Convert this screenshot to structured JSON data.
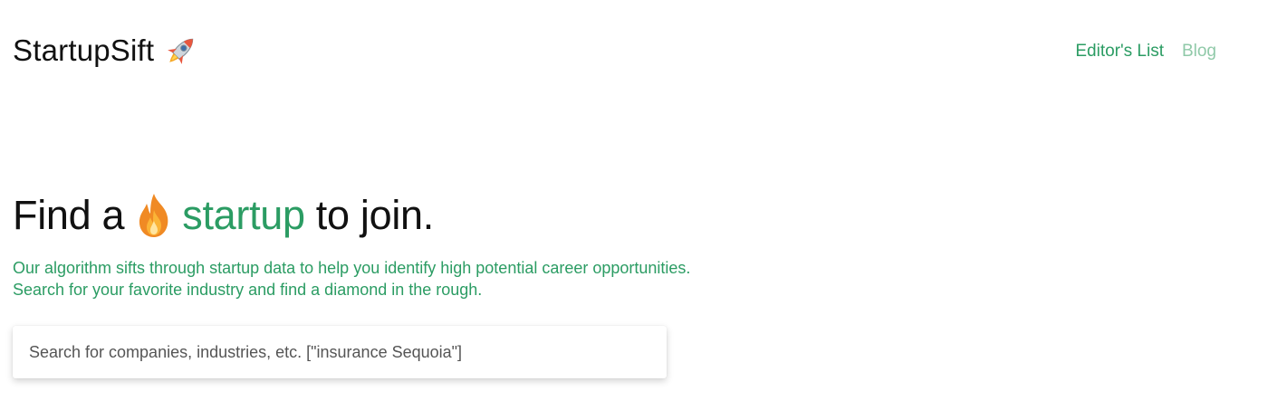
{
  "header": {
    "brand_name": "StartupSift",
    "brand_icon": "rocket-icon",
    "nav": [
      {
        "label": "Editor's List",
        "color": "#2b9c63"
      },
      {
        "label": "Blog",
        "color": "#8fc9a8"
      }
    ]
  },
  "hero": {
    "title_pre": "Find a",
    "title_icon": "fire-icon",
    "title_accent": "startup",
    "title_post": "to join.",
    "subtitle": "Our algorithm sifts through startup data to help you identify high potential career opportunities. Search for your favorite industry and find a diamond in the rough."
  },
  "search": {
    "placeholder": "Search for companies, industries, etc. [\"insurance Sequoia\"]",
    "value": ""
  },
  "colors": {
    "accent": "#2b9c63",
    "accent_muted": "#8fc9a8",
    "text": "#111111"
  }
}
